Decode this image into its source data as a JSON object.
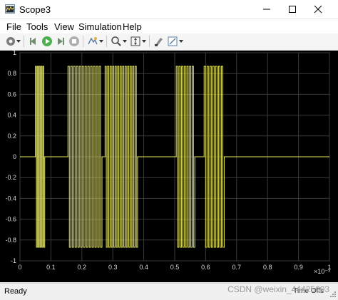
{
  "window": {
    "title": "Scope3",
    "controls": [
      "minimize-icon",
      "maximize-icon",
      "close-icon"
    ]
  },
  "menu": {
    "file": "File",
    "tools": "Tools",
    "view": "View",
    "simulation": "Simulation",
    "help": "Help"
  },
  "toolbar": {
    "icons": [
      "settings-icon",
      "dropdown-arrow",
      "step-back-icon",
      "run-icon",
      "step-forward-icon",
      "stop-icon",
      "highlight-icon",
      "dropdown-arrow",
      "zoom-icon",
      "dropdown-arrow",
      "fit-icon",
      "dropdown-arrow",
      "style-icon",
      "measure-icon",
      "dropdown-arrow"
    ]
  },
  "status": {
    "text": "Ready",
    "time_offset": "Time Offs",
    "watermark": "CSDN @weixin_44425603"
  },
  "chart_data": {
    "type": "line",
    "background": "#000000",
    "line_color": "#e6e65a",
    "grid": true,
    "xlim": [
      0,
      1
    ],
    "ylim": [
      -1,
      1
    ],
    "x_ticks": [
      "0",
      "0.1",
      "0.2",
      "0.3",
      "0.4",
      "0.5",
      "0.6",
      "0.7",
      "0.8",
      "0.9",
      "1"
    ],
    "y_ticks": [
      "1",
      "0.8",
      "0.6",
      "0.4",
      "0.2",
      "0",
      "-0.2",
      "-0.4",
      "-0.6",
      "-0.8",
      "-1"
    ],
    "x_exponent": "×10⁻³",
    "amplitude": 0.87,
    "bursts": [
      {
        "start": 0.05,
        "end": 0.08,
        "pulses": 5
      },
      {
        "start": 0.155,
        "end": 0.265,
        "pulses": 12
      },
      {
        "start": 0.275,
        "end": 0.38,
        "pulses": 13
      },
      {
        "start": 0.505,
        "end": 0.565,
        "pulses": 7
      },
      {
        "start": 0.595,
        "end": 0.66,
        "pulses": 7
      }
    ]
  }
}
